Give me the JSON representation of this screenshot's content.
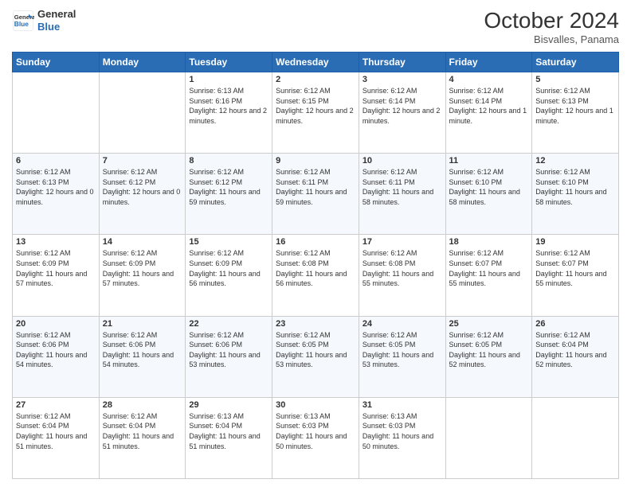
{
  "header": {
    "logo_line1": "General",
    "logo_line2": "Blue",
    "month_title": "October 2024",
    "location": "Bisvalles, Panama"
  },
  "weekdays": [
    "Sunday",
    "Monday",
    "Tuesday",
    "Wednesday",
    "Thursday",
    "Friday",
    "Saturday"
  ],
  "weeks": [
    [
      {
        "day": "",
        "sunrise": "",
        "sunset": "",
        "daylight": ""
      },
      {
        "day": "",
        "sunrise": "",
        "sunset": "",
        "daylight": ""
      },
      {
        "day": "1",
        "sunrise": "Sunrise: 6:13 AM",
        "sunset": "Sunset: 6:16 PM",
        "daylight": "Daylight: 12 hours and 2 minutes."
      },
      {
        "day": "2",
        "sunrise": "Sunrise: 6:12 AM",
        "sunset": "Sunset: 6:15 PM",
        "daylight": "Daylight: 12 hours and 2 minutes."
      },
      {
        "day": "3",
        "sunrise": "Sunrise: 6:12 AM",
        "sunset": "Sunset: 6:14 PM",
        "daylight": "Daylight: 12 hours and 2 minutes."
      },
      {
        "day": "4",
        "sunrise": "Sunrise: 6:12 AM",
        "sunset": "Sunset: 6:14 PM",
        "daylight": "Daylight: 12 hours and 1 minute."
      },
      {
        "day": "5",
        "sunrise": "Sunrise: 6:12 AM",
        "sunset": "Sunset: 6:13 PM",
        "daylight": "Daylight: 12 hours and 1 minute."
      }
    ],
    [
      {
        "day": "6",
        "sunrise": "Sunrise: 6:12 AM",
        "sunset": "Sunset: 6:13 PM",
        "daylight": "Daylight: 12 hours and 0 minutes."
      },
      {
        "day": "7",
        "sunrise": "Sunrise: 6:12 AM",
        "sunset": "Sunset: 6:12 PM",
        "daylight": "Daylight: 12 hours and 0 minutes."
      },
      {
        "day": "8",
        "sunrise": "Sunrise: 6:12 AM",
        "sunset": "Sunset: 6:12 PM",
        "daylight": "Daylight: 11 hours and 59 minutes."
      },
      {
        "day": "9",
        "sunrise": "Sunrise: 6:12 AM",
        "sunset": "Sunset: 6:11 PM",
        "daylight": "Daylight: 11 hours and 59 minutes."
      },
      {
        "day": "10",
        "sunrise": "Sunrise: 6:12 AM",
        "sunset": "Sunset: 6:11 PM",
        "daylight": "Daylight: 11 hours and 58 minutes."
      },
      {
        "day": "11",
        "sunrise": "Sunrise: 6:12 AM",
        "sunset": "Sunset: 6:10 PM",
        "daylight": "Daylight: 11 hours and 58 minutes."
      },
      {
        "day": "12",
        "sunrise": "Sunrise: 6:12 AM",
        "sunset": "Sunset: 6:10 PM",
        "daylight": "Daylight: 11 hours and 58 minutes."
      }
    ],
    [
      {
        "day": "13",
        "sunrise": "Sunrise: 6:12 AM",
        "sunset": "Sunset: 6:09 PM",
        "daylight": "Daylight: 11 hours and 57 minutes."
      },
      {
        "day": "14",
        "sunrise": "Sunrise: 6:12 AM",
        "sunset": "Sunset: 6:09 PM",
        "daylight": "Daylight: 11 hours and 57 minutes."
      },
      {
        "day": "15",
        "sunrise": "Sunrise: 6:12 AM",
        "sunset": "Sunset: 6:09 PM",
        "daylight": "Daylight: 11 hours and 56 minutes."
      },
      {
        "day": "16",
        "sunrise": "Sunrise: 6:12 AM",
        "sunset": "Sunset: 6:08 PM",
        "daylight": "Daylight: 11 hours and 56 minutes."
      },
      {
        "day": "17",
        "sunrise": "Sunrise: 6:12 AM",
        "sunset": "Sunset: 6:08 PM",
        "daylight": "Daylight: 11 hours and 55 minutes."
      },
      {
        "day": "18",
        "sunrise": "Sunrise: 6:12 AM",
        "sunset": "Sunset: 6:07 PM",
        "daylight": "Daylight: 11 hours and 55 minutes."
      },
      {
        "day": "19",
        "sunrise": "Sunrise: 6:12 AM",
        "sunset": "Sunset: 6:07 PM",
        "daylight": "Daylight: 11 hours and 55 minutes."
      }
    ],
    [
      {
        "day": "20",
        "sunrise": "Sunrise: 6:12 AM",
        "sunset": "Sunset: 6:06 PM",
        "daylight": "Daylight: 11 hours and 54 minutes."
      },
      {
        "day": "21",
        "sunrise": "Sunrise: 6:12 AM",
        "sunset": "Sunset: 6:06 PM",
        "daylight": "Daylight: 11 hours and 54 minutes."
      },
      {
        "day": "22",
        "sunrise": "Sunrise: 6:12 AM",
        "sunset": "Sunset: 6:06 PM",
        "daylight": "Daylight: 11 hours and 53 minutes."
      },
      {
        "day": "23",
        "sunrise": "Sunrise: 6:12 AM",
        "sunset": "Sunset: 6:05 PM",
        "daylight": "Daylight: 11 hours and 53 minutes."
      },
      {
        "day": "24",
        "sunrise": "Sunrise: 6:12 AM",
        "sunset": "Sunset: 6:05 PM",
        "daylight": "Daylight: 11 hours and 53 minutes."
      },
      {
        "day": "25",
        "sunrise": "Sunrise: 6:12 AM",
        "sunset": "Sunset: 6:05 PM",
        "daylight": "Daylight: 11 hours and 52 minutes."
      },
      {
        "day": "26",
        "sunrise": "Sunrise: 6:12 AM",
        "sunset": "Sunset: 6:04 PM",
        "daylight": "Daylight: 11 hours and 52 minutes."
      }
    ],
    [
      {
        "day": "27",
        "sunrise": "Sunrise: 6:12 AM",
        "sunset": "Sunset: 6:04 PM",
        "daylight": "Daylight: 11 hours and 51 minutes."
      },
      {
        "day": "28",
        "sunrise": "Sunrise: 6:12 AM",
        "sunset": "Sunset: 6:04 PM",
        "daylight": "Daylight: 11 hours and 51 minutes."
      },
      {
        "day": "29",
        "sunrise": "Sunrise: 6:13 AM",
        "sunset": "Sunset: 6:04 PM",
        "daylight": "Daylight: 11 hours and 51 minutes."
      },
      {
        "day": "30",
        "sunrise": "Sunrise: 6:13 AM",
        "sunset": "Sunset: 6:03 PM",
        "daylight": "Daylight: 11 hours and 50 minutes."
      },
      {
        "day": "31",
        "sunrise": "Sunrise: 6:13 AM",
        "sunset": "Sunset: 6:03 PM",
        "daylight": "Daylight: 11 hours and 50 minutes."
      },
      {
        "day": "",
        "sunrise": "",
        "sunset": "",
        "daylight": ""
      },
      {
        "day": "",
        "sunrise": "",
        "sunset": "",
        "daylight": ""
      }
    ]
  ]
}
